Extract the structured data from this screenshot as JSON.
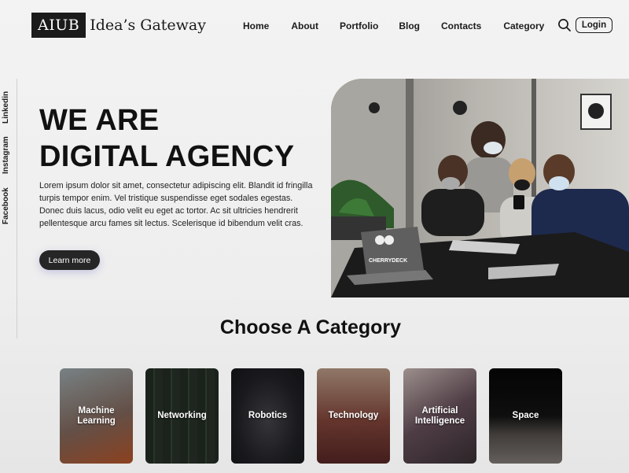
{
  "brand": {
    "logo_box": "AIUB",
    "logo_text": "Idea’s Gateway"
  },
  "nav": {
    "items": [
      "Home",
      "About",
      "Portfolio",
      "Blog",
      "Contacts",
      "Category"
    ]
  },
  "header": {
    "login_label": "Login",
    "search_icon": "search-icon"
  },
  "social": [
    "Linkedin",
    "Instagram",
    "Facebook"
  ],
  "hero": {
    "title_line1": "WE ARE",
    "title_line2": "DIGITAL AGENCY",
    "body": "Lorem ipsum dolor sit amet, consectetur adipiscing elit. Blandit id fringilla turpis tempor enim. Vel tristique suspendisse eget sodales egestas. Donec duis lacus, odio velit eu eget ac tortor. Ac sit ultricies hendrerit pellentesque arcu fames sit lectus. Scelerisque id bibendum velit cras.",
    "button": "Learn more",
    "photo_sticker": "CHERRYDECK"
  },
  "category": {
    "title": "Choose A Category",
    "cards": [
      {
        "label": "Machine Learning",
        "color": "#8a6f63"
      },
      {
        "label": "Networking",
        "color": "#2f3a33"
      },
      {
        "label": "Robotics",
        "color": "#2a2b30"
      },
      {
        "label": "Technology",
        "color": "#7a3b33"
      },
      {
        "label": "Artificial Intelligence",
        "color": "#5a4a52"
      },
      {
        "label": "Space",
        "color": "#1c1c1c"
      }
    ]
  },
  "colors": {
    "dark": "#1b1b1b",
    "button": "#262626"
  }
}
